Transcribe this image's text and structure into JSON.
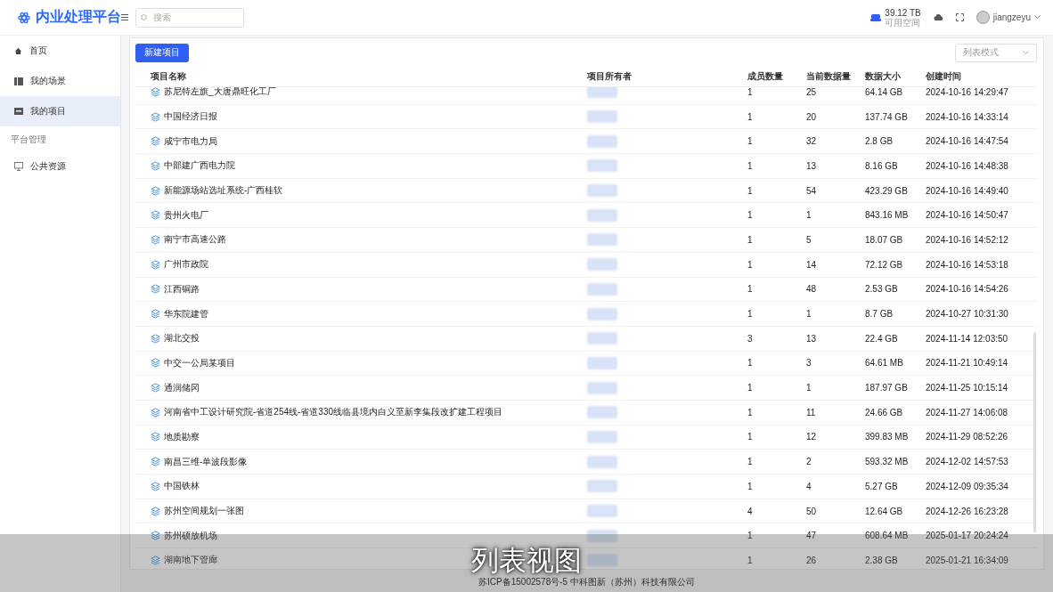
{
  "brand": {
    "title": "内业处理平台"
  },
  "search": {
    "placeholder": "搜索"
  },
  "storage": {
    "amount": "39.12 TB",
    "label": "可用空间"
  },
  "user": {
    "name": "jiangzeyu"
  },
  "sidebar": {
    "items": [
      {
        "label": "首页",
        "selected": false
      },
      {
        "label": "我的场景",
        "selected": false
      },
      {
        "label": "我的项目",
        "selected": true
      }
    ],
    "section": "平台管理",
    "section_items": [
      {
        "label": "公共资源",
        "selected": false
      }
    ]
  },
  "toolbar": {
    "new_button": "新建项目",
    "view_select": "列表模式"
  },
  "table": {
    "columns": [
      "项目名称",
      "项目所有者",
      "成员数量",
      "当前数据量",
      "数据大小",
      "创建时间"
    ],
    "rows": [
      {
        "name": "苏尼特左旗_大唐鼎旺化工厂",
        "members": "1",
        "count": "25",
        "size": "64.14 GB",
        "created": "2024-10-16 14:29:47"
      },
      {
        "name": "中国经济日报",
        "members": "1",
        "count": "20",
        "size": "137.74 GB",
        "created": "2024-10-16 14:33:14"
      },
      {
        "name": "咸宁市电力局",
        "members": "1",
        "count": "32",
        "size": "2.8 GB",
        "created": "2024-10-16 14:47:54"
      },
      {
        "name": "中部建广西电力院",
        "members": "1",
        "count": "13",
        "size": "8.16 GB",
        "created": "2024-10-16 14:48:38"
      },
      {
        "name": "新能源场站选址系统-广西桂软",
        "members": "1",
        "count": "54",
        "size": "423.29 GB",
        "created": "2024-10-16 14:49:40"
      },
      {
        "name": "贵州火电厂",
        "members": "1",
        "count": "1",
        "size": "843.16 MB",
        "created": "2024-10-16 14:50:47"
      },
      {
        "name": "南宁市高速公路",
        "members": "1",
        "count": "5",
        "size": "18.07 GB",
        "created": "2024-10-16 14:52:12"
      },
      {
        "name": "广州市政院",
        "members": "1",
        "count": "14",
        "size": "72.12 GB",
        "created": "2024-10-16 14:53:18"
      },
      {
        "name": "江西铜路",
        "members": "1",
        "count": "48",
        "size": "2.53 GB",
        "created": "2024-10-16 14:54:26"
      },
      {
        "name": "华东院建管",
        "members": "1",
        "count": "1",
        "size": "8.7 GB",
        "created": "2024-10-27 10:31:30"
      },
      {
        "name": "湖北交投",
        "members": "3",
        "count": "13",
        "size": "22.4 GB",
        "created": "2024-11-14 12:03:50"
      },
      {
        "name": "中交一公局某项目",
        "members": "1",
        "count": "3",
        "size": "64.61 MB",
        "created": "2024-11-21 10:49:14"
      },
      {
        "name": "通润储冈",
        "members": "1",
        "count": "1",
        "size": "187.97 GB",
        "created": "2024-11-25 10:15:14"
      },
      {
        "name": "河南省中工设计研究院-省道254线-省道330线临县境内白义至新李集段改扩建工程项目",
        "members": "1",
        "count": "11",
        "size": "24.66 GB",
        "created": "2024-11-27 14:06:08"
      },
      {
        "name": "地质勘察",
        "members": "1",
        "count": "12",
        "size": "399.83 MB",
        "created": "2024-11-29 08:52:26"
      },
      {
        "name": "南昌三维-单波段影像",
        "members": "1",
        "count": "2",
        "size": "593.32 MB",
        "created": "2024-12-02 14:57:53"
      },
      {
        "name": "中国铁林",
        "members": "1",
        "count": "4",
        "size": "5.27 GB",
        "created": "2024-12-09 09:35:34"
      },
      {
        "name": "苏州空间规划一张图",
        "members": "4",
        "count": "50",
        "size": "12.64 GB",
        "created": "2024-12-26 16:23:28"
      },
      {
        "name": "苏州硕放机场",
        "members": "1",
        "count": "47",
        "size": "608.64 MB",
        "created": "2025-01-17 20:24:24"
      },
      {
        "name": "湖南地下管廊",
        "members": "1",
        "count": "26",
        "size": "2.38 GB",
        "created": "2025-01-21 16:34:09"
      }
    ]
  },
  "footer": "苏ICP备15002578号-5 中科图新（苏州）科技有限公司",
  "caption": "列表视图"
}
